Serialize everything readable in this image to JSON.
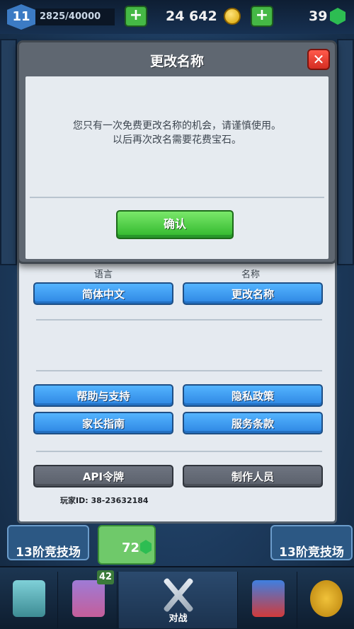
{
  "hud": {
    "level": "11",
    "xp": "2825/40000",
    "gold": "24 642",
    "gems": "39",
    "plus_label": "+"
  },
  "modal": {
    "title": "更改名称",
    "close": "✕",
    "message_line1": "您只有一次免费更改名称的机会，请谨慎使用。",
    "message_line2": "以后再次改名需要花费宝石。",
    "confirm_label": "确认"
  },
  "settings": {
    "language_header": "语言",
    "name_header": "名称",
    "language_button": "简体中文",
    "rename_button": "更改名称",
    "help_button": "帮助与支持",
    "privacy_button": "隐私政策",
    "parents_button": "家长指南",
    "terms_button": "服务条款",
    "api_button": "API令牌",
    "credits_button": "制作人员",
    "player_id": "玩家ID: 38-23632184"
  },
  "arena": {
    "left_label": "13阶竞技场",
    "right_label": "13阶竞技场",
    "reward_count": "72"
  },
  "nav": {
    "cards_badge": "42",
    "battle_label": "对战"
  },
  "colors": {
    "confirm_green": "#2fb62b",
    "button_blue": "#2d86e3",
    "button_grey": "#5a606b",
    "close_red": "#d42d22"
  }
}
